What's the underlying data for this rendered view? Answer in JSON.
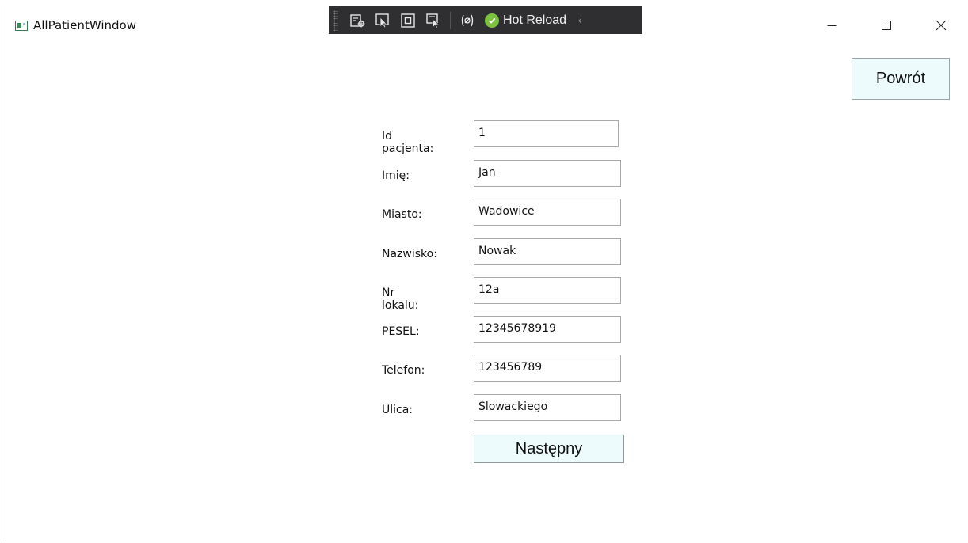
{
  "window": {
    "title": "AllPatientWindow"
  },
  "debug_toolbar": {
    "icons": [
      "live-visual-tree-icon",
      "select-element-icon",
      "display-layout-adorners-icon",
      "track-focus-icon",
      "binding-failures-icon"
    ],
    "hot_reload_label": "Hot Reload",
    "collapse_icon": "chevron-left-icon"
  },
  "caption_buttons": [
    "minimize-icon",
    "maximize-icon",
    "close-icon"
  ],
  "back_button": {
    "label": "Powrót"
  },
  "form": {
    "fields": [
      {
        "label": "Id pacjenta:",
        "value": "1"
      },
      {
        "label": "Imię:",
        "value": "Jan"
      },
      {
        "label": "Miasto:",
        "value": "Wadowice"
      },
      {
        "label": "Nazwisko:",
        "value": "Nowak"
      },
      {
        "label": "Nr lokalu:",
        "value": "12a"
      },
      {
        "label": "PESEL:",
        "value": "12345678919"
      },
      {
        "label": "Telefon:",
        "value": "123456789"
      },
      {
        "label": "Ulica:",
        "value": "Slowackiego"
      }
    ],
    "next_button": {
      "label": "Następny"
    }
  },
  "colors": {
    "button_bg": "#edfbfc",
    "toolbar_bg": "#2f2f31",
    "hot_reload_check": "#7cc241"
  }
}
